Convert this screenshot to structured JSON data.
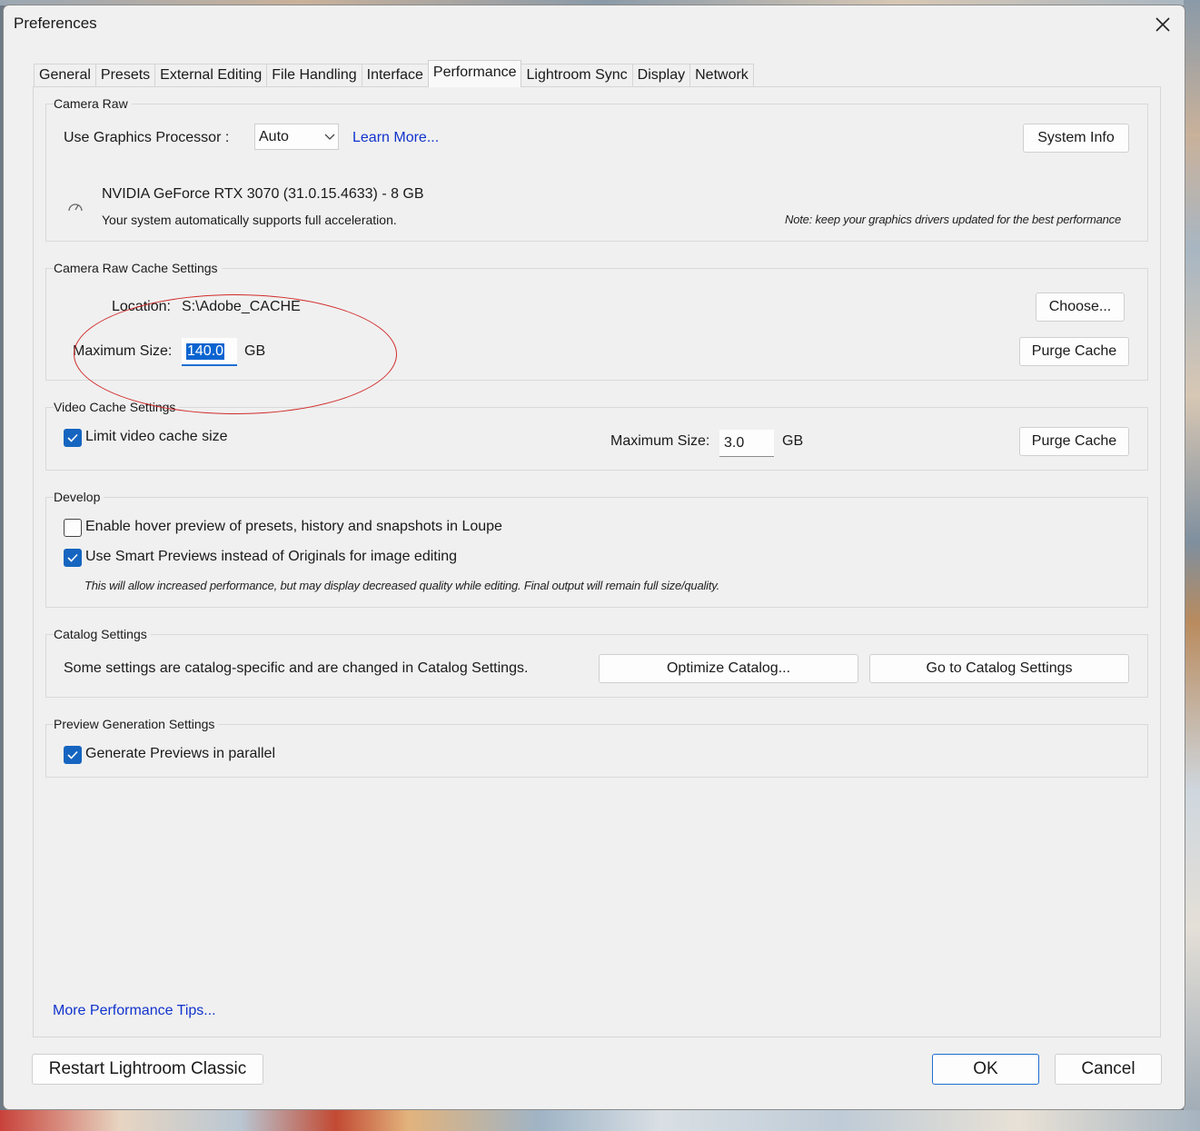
{
  "window": {
    "title": "Preferences",
    "close_icon": "close-icon"
  },
  "tabs": [
    {
      "label": "General"
    },
    {
      "label": "Presets"
    },
    {
      "label": "External Editing"
    },
    {
      "label": "File Handling"
    },
    {
      "label": "Interface"
    },
    {
      "label": "Performance",
      "active": true
    },
    {
      "label": "Lightroom Sync"
    },
    {
      "label": "Display"
    },
    {
      "label": "Network"
    }
  ],
  "camera_raw": {
    "title": "Camera Raw",
    "gpu_label": "Use Graphics Processor :",
    "gpu_value": "Auto",
    "learn_more": "Learn More...",
    "system_info": "System Info",
    "gpu_name": "NVIDIA GeForce RTX 3070 (31.0.15.4633) - 8 GB",
    "gpu_status": "Your system automatically supports full acceleration.",
    "gpu_note": "Note: keep your graphics drivers updated for the best performance"
  },
  "cache": {
    "title": "Camera Raw Cache Settings",
    "location_label": "Location:",
    "location_value": "S:\\Adobe_CACHE",
    "choose": "Choose...",
    "max_size_label": "Maximum Size:",
    "max_size_value": "140.0",
    "unit": "GB",
    "purge": "Purge Cache"
  },
  "video_cache": {
    "title": "Video Cache Settings",
    "limit_label": "Limit video cache size",
    "limit_checked": true,
    "max_size_label": "Maximum Size:",
    "max_size_value": "3.0",
    "unit": "GB",
    "purge": "Purge Cache"
  },
  "develop": {
    "title": "Develop",
    "hover_label": "Enable hover preview of presets, history and snapshots in Loupe",
    "hover_checked": false,
    "smart_label": "Use Smart Previews instead of Originals for image editing",
    "smart_checked": true,
    "smart_note": "This will allow increased performance, but may display decreased quality while editing. Final output will remain full size/quality."
  },
  "catalog": {
    "title": "Catalog Settings",
    "text": "Some settings are catalog-specific and are changed in Catalog Settings.",
    "optimize": "Optimize Catalog...",
    "goto": "Go to Catalog Settings"
  },
  "preview": {
    "title": "Preview Generation Settings",
    "parallel_label": "Generate Previews in parallel",
    "parallel_checked": true
  },
  "footer": {
    "tips_link": "More Performance Tips...",
    "restart": "Restart Lightroom Classic",
    "ok": "OK",
    "cancel": "Cancel"
  },
  "colors": {
    "accent": "#1565c0",
    "link": "#1133cc",
    "annotation": "#d12a2a",
    "dialog_bg": "#f0f0f0"
  }
}
